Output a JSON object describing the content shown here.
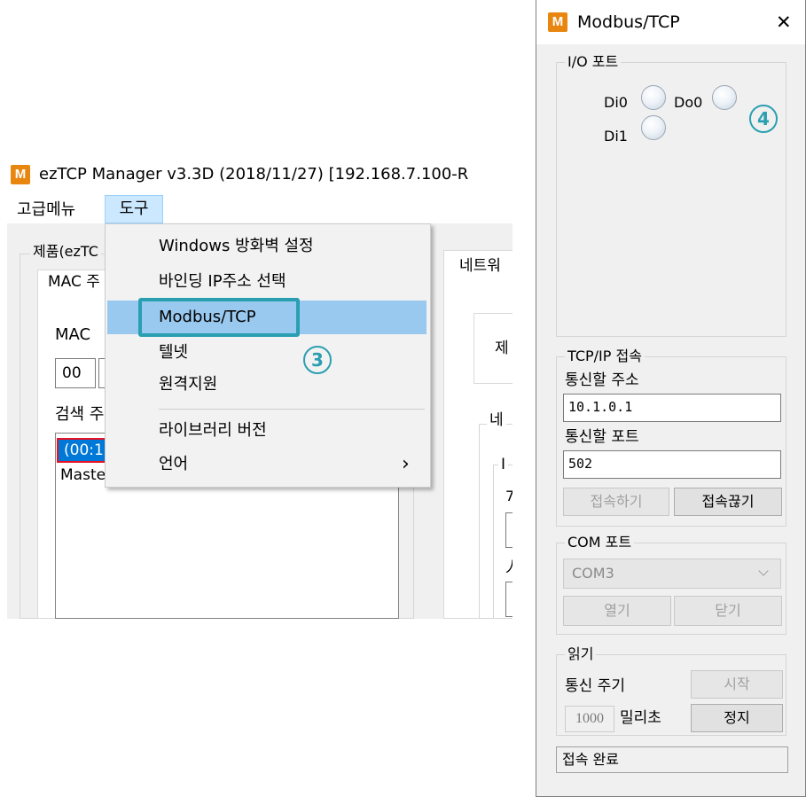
{
  "left_window": {
    "title": "ezTCP Manager v3.3D (2018/11/27) [192.168.7.100-R",
    "menubar": [
      "고급메뉴",
      "도구"
    ],
    "product_group": "제품(ezTC",
    "search_tab": "MAC 주",
    "mac_label": "MAC",
    "mac_first": "00",
    "search_label": "검색 주",
    "list_items": [
      "(00:1",
      "Maste"
    ],
    "right_tab": "네트워",
    "right_label_1": "제",
    "right_group": "네",
    "right_sub_1": "I",
    "right_sub_2": "7",
    "right_sub_3": "人"
  },
  "dropdown_menu": {
    "items": [
      {
        "label": "Windows 방화벽 설정"
      },
      {
        "label": "바인딩 IP주소 선택"
      },
      {
        "label": "Modbus/TCP",
        "highlighted": true
      },
      {
        "label": "텔넷"
      },
      {
        "label": "원격지원"
      },
      {
        "label": "라이브러리 버전"
      },
      {
        "label": "언어",
        "submenu": true
      }
    ],
    "submenu_arrow": "›"
  },
  "callouts": {
    "menu": "3",
    "io": "4"
  },
  "modbus_window": {
    "title": "Modbus/TCP",
    "close": "✕",
    "io_group": {
      "title": "I/O 포트",
      "inputs": [
        "Di0",
        "Di1"
      ],
      "outputs": [
        "Do0"
      ]
    },
    "tcp_group": {
      "title": "TCP/IP 접속",
      "address_label": "통신할 주소",
      "address_value": "10.1.0.1",
      "port_label": "통신할 포트",
      "port_value": "502",
      "connect_button": "접속하기",
      "disconnect_button": "접속끊기"
    },
    "com_group": {
      "title": "COM 포트",
      "selected_port": "COM3",
      "open_button": "열기",
      "close_button": "닫기"
    },
    "read_group": {
      "title": "읽기",
      "interval_label": "통신 주기",
      "interval_value": "1000",
      "unit": "밀리초",
      "start_button": "시작",
      "stop_button": "정지"
    },
    "status": "접속 완료"
  },
  "colors": {
    "highlight": "#99c9ef",
    "callout": "#2a9fb1",
    "app_icon": "#e8860f",
    "dialog_bg": "#f0f0f0"
  }
}
